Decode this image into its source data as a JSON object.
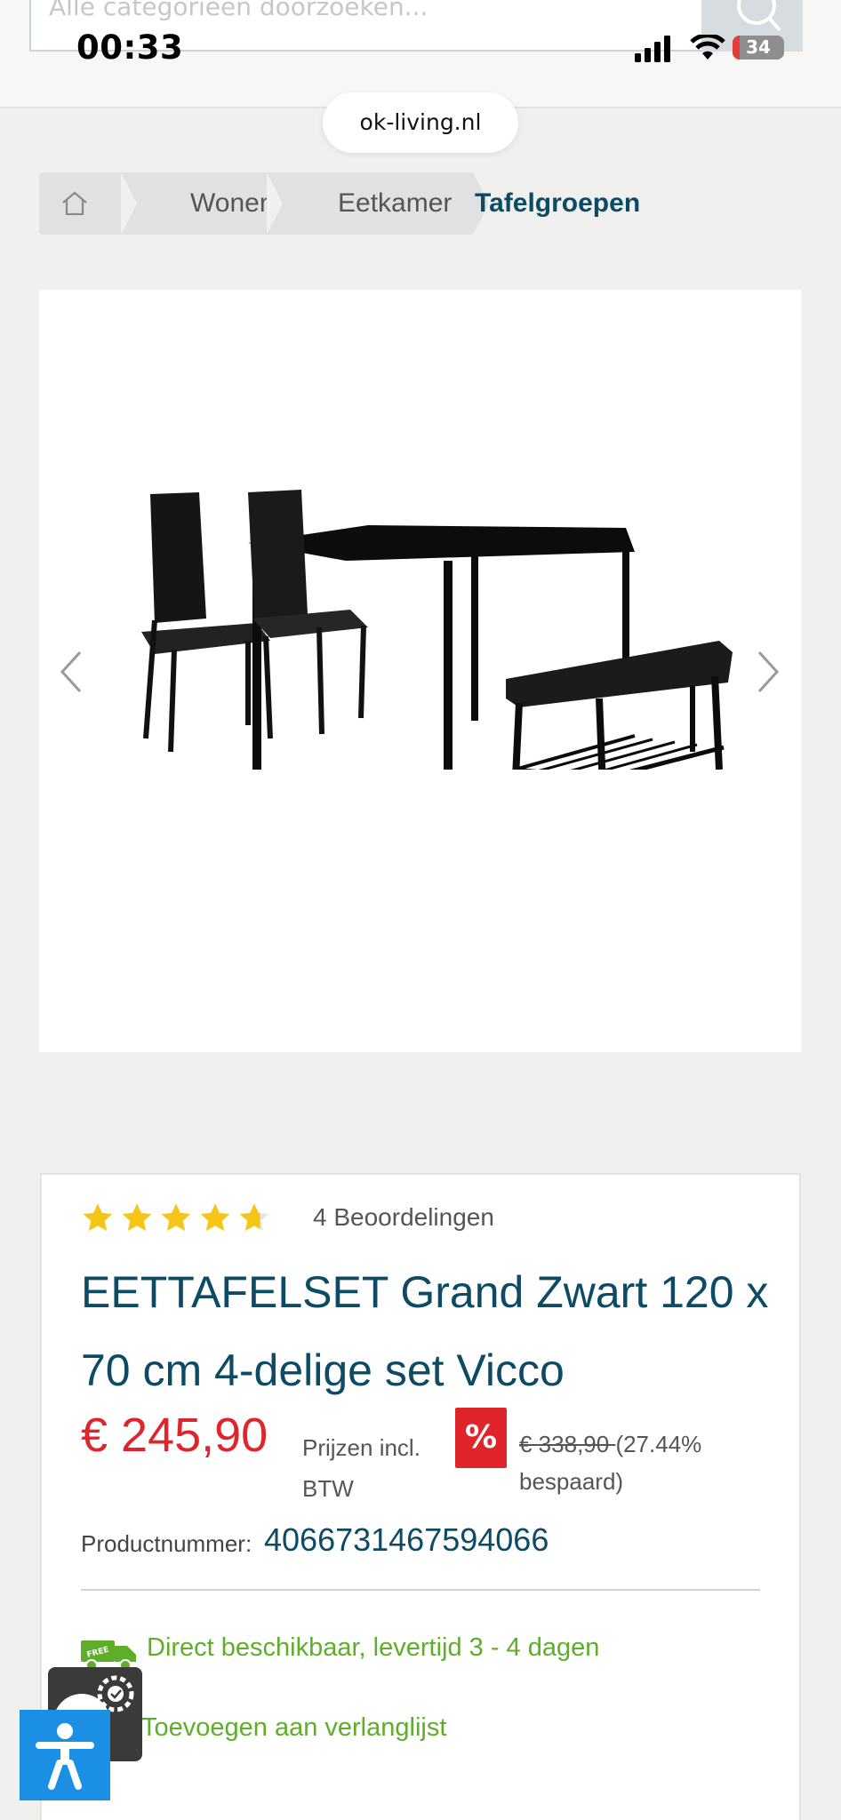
{
  "status_bar": {
    "time": "00:33",
    "battery": "34"
  },
  "search": {
    "placeholder": "Alle categorieën doorzoeken..."
  },
  "browser": {
    "url": "ok-living.nl"
  },
  "breadcrumb": {
    "items": [
      "Wonen",
      "Eetkamer"
    ],
    "active": "Tafelgroepen"
  },
  "product": {
    "rating_stars": 4.5,
    "reviews": "4 Beoordelingen",
    "title": "EETTAFELSET Grand Zwart 120 x 70 cm 4-delige set Vicco",
    "price": "€ 245,90",
    "vat_note": "Prijzen incl. BTW",
    "discount_symbol": "%",
    "old_price": "€ 338,90 ",
    "savings": "(27.44% bespaard)",
    "product_number_label": "Productnummer:",
    "product_number": "4066731467594066",
    "delivery": "Direct beschikbaar, levertijd 3 - 4 dagen",
    "wishlist": "Toevoegen aan verlanglijst",
    "free_badge": "FREE"
  },
  "colors": {
    "brand": "#0d4a63",
    "price": "#e0242c",
    "green": "#5fae2a",
    "star": "#f5c518"
  }
}
